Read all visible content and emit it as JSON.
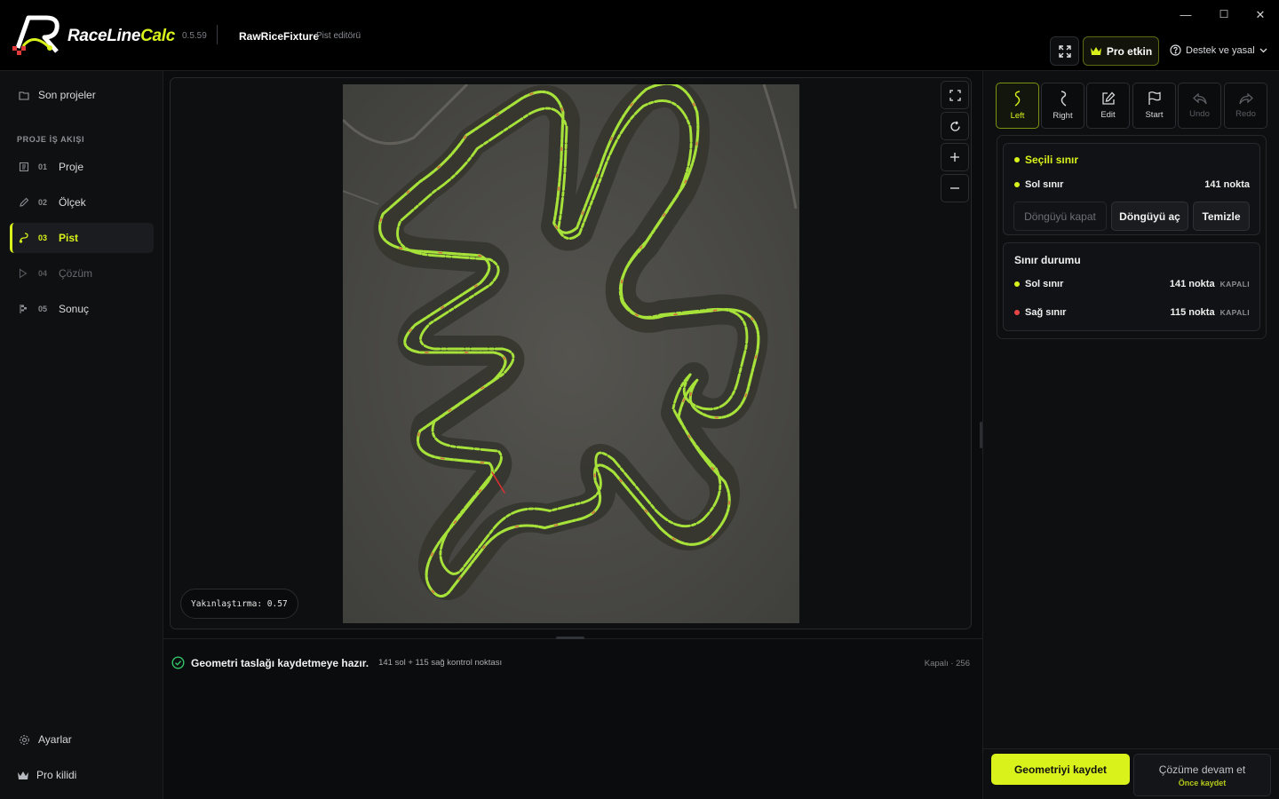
{
  "app": {
    "name_part1": "RaceLine",
    "name_part2": "Calc",
    "version": "0.5.59",
    "project_name": "RawRiceFixture",
    "project_subtitle": "Pist editörü"
  },
  "window_controls": {
    "minimize": "—",
    "maximize": "☐",
    "close": "✕"
  },
  "header": {
    "pro_label": "Pro etkin",
    "support_label": "Destek ve yasal"
  },
  "sidebar": {
    "recent_label": "Son projeler",
    "section_label": "PROJE İŞ AKIŞI",
    "items": [
      {
        "num": "01",
        "label": "Proje"
      },
      {
        "num": "02",
        "label": "Ölçek"
      },
      {
        "num": "03",
        "label": "Pist"
      },
      {
        "num": "04",
        "label": "Çözüm"
      },
      {
        "num": "05",
        "label": "Sonuç"
      }
    ],
    "settings_label": "Ayarlar",
    "pro_lock_label": "Pro kilidi"
  },
  "canvas": {
    "zoom_label": "Yakınlaştırma: 0.57"
  },
  "status": {
    "message": "Geometri taslağı kaydetmeye hazır.",
    "detail": "141 sol + 115 sağ kontrol noktası",
    "right": "Kapalı · 256"
  },
  "toolbar": [
    {
      "label": "Left"
    },
    {
      "label": "Right"
    },
    {
      "label": "Edit"
    },
    {
      "label": "Start"
    },
    {
      "label": "Undo"
    },
    {
      "label": "Redo"
    }
  ],
  "selected": {
    "title": "Seçili sınır",
    "boundary": "Sol sınır",
    "points": "141 nokta",
    "btn_close_loop": "Döngüyü kapat",
    "btn_open_loop": "Döngüyü aç",
    "btn_clear": "Temizle"
  },
  "boundary_status": {
    "title": "Sınır durumu",
    "rows": [
      {
        "name": "Sol sınır",
        "points": "141 nokta",
        "state": "KAPALI"
      },
      {
        "name": "Sağ sınır",
        "points": "115 nokta",
        "state": "KAPALI"
      }
    ]
  },
  "actions": {
    "save_geometry": "Geometriyi kaydet",
    "continue": "Çözüme devam et",
    "continue_hint": "Önce kaydet"
  },
  "colors": {
    "accent": "#d9f21b",
    "left_dot": "#d9f21b",
    "right_dot": "#e84545",
    "status_ok": "#35c46a"
  }
}
